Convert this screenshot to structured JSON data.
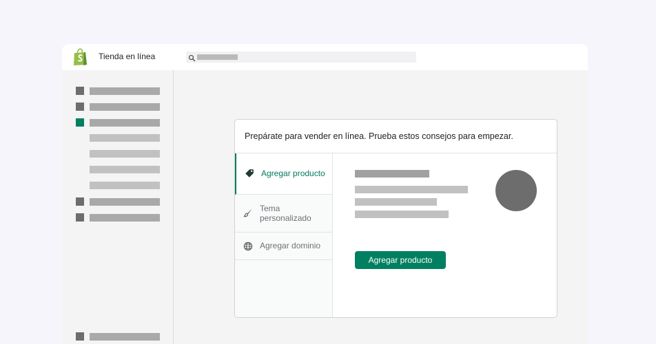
{
  "topbar": {
    "app_title": "Tienda en línea",
    "logo_icon": "shopify-bag-icon",
    "search_icon": "search-icon"
  },
  "card": {
    "title": "Prepárate para vender en línea. Prueba estos consejos para empezar.",
    "tabs": [
      {
        "label": "Agregar producto",
        "icon": "tag-icon",
        "active": true
      },
      {
        "label": "Tema personalizado",
        "icon": "paintbrush-icon",
        "active": false
      },
      {
        "label": "Agregar dominio",
        "icon": "globe-icon",
        "active": false
      }
    ],
    "cta_label": "Agregar producto"
  },
  "colors": {
    "accent": "#008060",
    "avatar": "#6d6d6d",
    "logo": "#95bf47"
  }
}
